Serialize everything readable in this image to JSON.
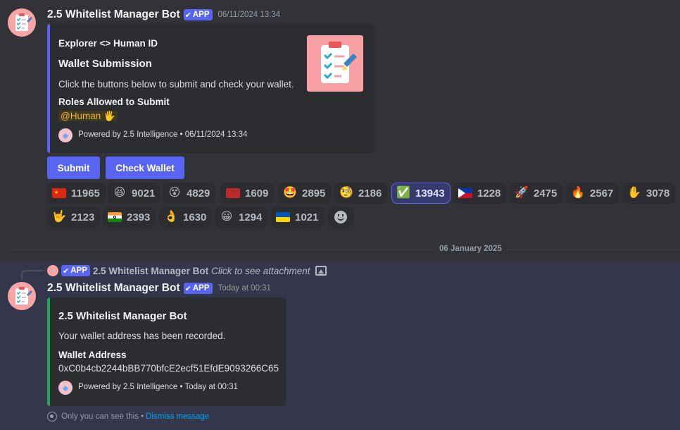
{
  "message1": {
    "author": "2.5 Whitelist Manager Bot",
    "badge": "APP",
    "timestamp": "06/11/2024 13:34",
    "embed": {
      "accent_color": "#5865f2",
      "author": "Explorer <> Human ID",
      "title": "Wallet Submission",
      "description": "Click the buttons below to submit and check your wallet.",
      "field_name": "Roles Allowed to Submit",
      "field_value_mention": "@Human",
      "field_value_emoji": "🖐",
      "footer_text": "Powered by 2.5 Intelligence • 06/11/2024 13:34",
      "thumbnail_icon": "clipboard-checklist-icon"
    },
    "buttons": {
      "submit": "Submit",
      "check_wallet": "Check Wallet"
    },
    "reactions_row1": [
      {
        "icon": "china-flag-icon",
        "count": "11965"
      },
      {
        "icon": "laughing-face-icon",
        "emoji": "😆",
        "count": "9021"
      },
      {
        "icon": "face-with-spiral-eyes-icon",
        "emoji": "😵",
        "count": "4829"
      },
      {
        "icon": "morocco-flag-icon",
        "count": "1609"
      },
      {
        "icon": "star-struck-icon",
        "emoji": "🤩",
        "count": "2895"
      },
      {
        "icon": "monocle-face-icon",
        "emoji": "🧐",
        "count": "2186"
      },
      {
        "icon": "check-mark-button-icon",
        "emoji": "✅",
        "count": "13943",
        "me": true
      },
      {
        "icon": "philippines-flag-icon",
        "count": "1228"
      },
      {
        "icon": "rocket-icon",
        "emoji": "🚀",
        "count": "2475"
      },
      {
        "icon": "fire-icon",
        "emoji": "🔥",
        "count": "2567"
      },
      {
        "icon": "raised-hand-icon",
        "emoji": "✋",
        "count": "3078"
      }
    ],
    "reactions_row2": [
      {
        "icon": "love-you-gesture-icon",
        "emoji": "🤟",
        "count": "2123"
      },
      {
        "icon": "india-flag-icon",
        "count": "2393"
      },
      {
        "icon": "ok-hand-icon",
        "emoji": "👌",
        "count": "1630"
      },
      {
        "icon": "grinning-face-icon",
        "emoji": "😀",
        "count": "1294"
      },
      {
        "icon": "ukraine-flag-icon",
        "count": "1021"
      }
    ]
  },
  "date_divider": "06 January 2025",
  "reply": {
    "author": "2.5 Whitelist Manager Bot",
    "badge": "APP",
    "text": "Click to see attachment"
  },
  "message2": {
    "author": "2.5 Whitelist Manager Bot",
    "badge": "APP",
    "timestamp": "Today at 00:31",
    "embed": {
      "accent_color": "#23a55a",
      "title": "2.5 Whitelist Manager Bot",
      "description": "Your wallet address has been recorded.",
      "field_name": "Wallet Address",
      "field_value": "0xC0b4cb2244bBB770bfcE2ecf51EfdE9093266C65",
      "footer_text": "Powered by 2.5 Intelligence • Today at 00:31"
    },
    "ephemeral_note": "Only you can see this •",
    "dismiss_link": "Dismiss message"
  }
}
